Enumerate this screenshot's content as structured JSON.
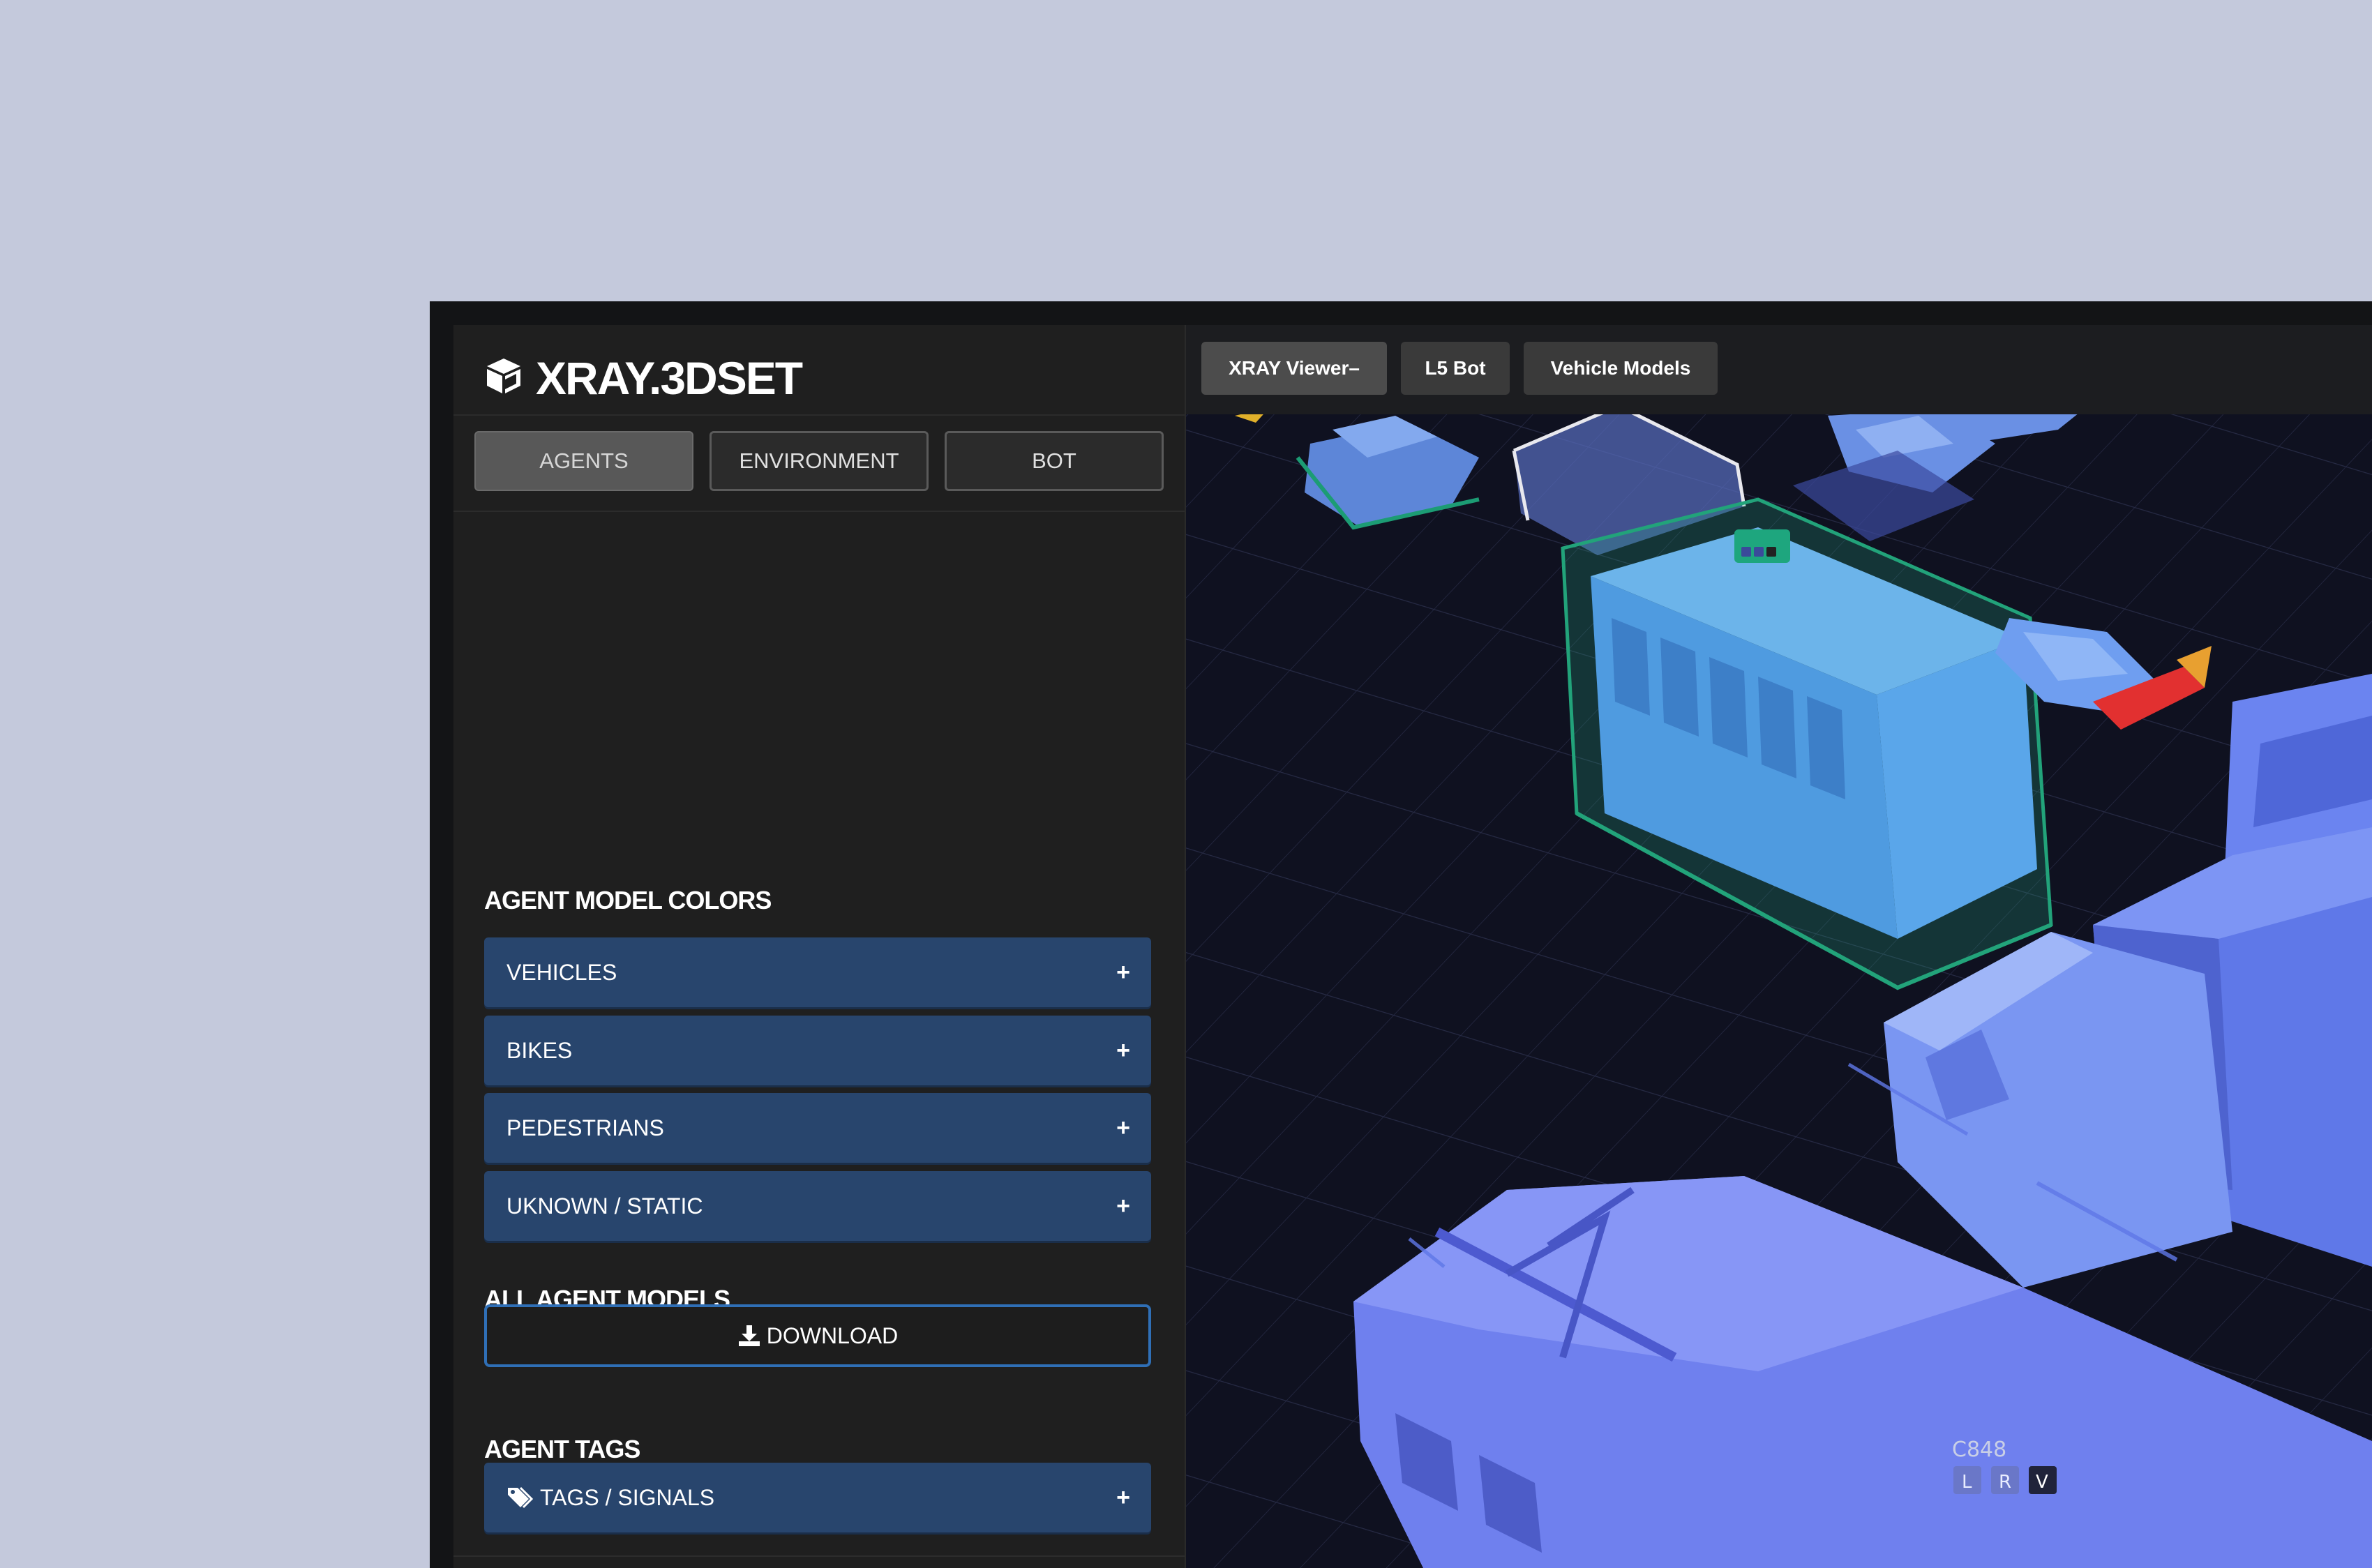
{
  "app": {
    "title": "XRAY.3DSET",
    "logo_icon": "cube-icon"
  },
  "sidebar": {
    "tabs": [
      {
        "label": "AGENTS",
        "active": true
      },
      {
        "label": "ENVIRONMENT",
        "active": false
      },
      {
        "label": "BOT",
        "active": false
      }
    ],
    "agent_model_colors": {
      "title": "AGENT MODEL COLORS",
      "items": [
        {
          "label": "VEHICLES",
          "icon": "plus-icon"
        },
        {
          "label": "BIKES",
          "icon": "plus-icon"
        },
        {
          "label": "PEDESTRIANS",
          "icon": "plus-icon"
        },
        {
          "label": "UKNOWN / STATIC",
          "icon": "plus-icon"
        }
      ]
    },
    "all_agent_models": {
      "title": "ALL AGENT MODELS",
      "download_label": "DOWNLOAD",
      "download_icon": "download-icon"
    },
    "agent_tags": {
      "title": "AGENT TAGS",
      "item_label": "TAGS / SIGNALS",
      "item_icon": "tags-icon"
    }
  },
  "viewer": {
    "tabs": [
      {
        "label": "XRAY Viewer–",
        "active": true
      },
      {
        "label": "L5 Bot",
        "active": false
      },
      {
        "label": "Vehicle Models",
        "active": false
      }
    ],
    "agent_tag": {
      "id": "C848",
      "buttons": [
        "L",
        "R",
        "V"
      ]
    }
  },
  "colors": {
    "page_background": "#c4c9dc",
    "panel": "#1f1f1f",
    "accordion": "#28456d",
    "download_border": "#2f6fb6",
    "selection_green": "#22a37a",
    "vehicle_blue": "#6f84f0",
    "grid": "#0f1120"
  }
}
